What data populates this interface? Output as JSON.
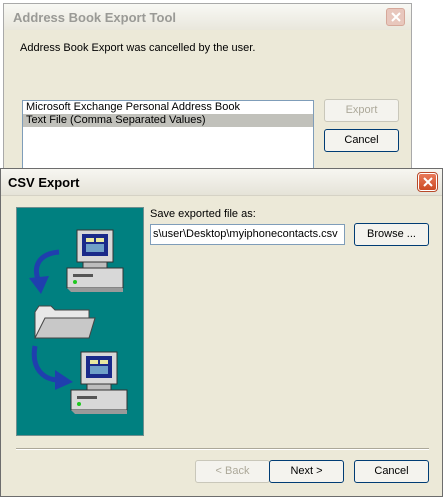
{
  "back_dialog": {
    "title": "Address Book Export Tool",
    "message": "Address Book Export was cancelled by the user.",
    "list_items": [
      {
        "label": "Microsoft Exchange Personal Address Book",
        "selected": false
      },
      {
        "label": "Text File (Comma Separated Values)",
        "selected": true
      }
    ],
    "export_label": "Export",
    "cancel_label": "Cancel"
  },
  "front_dialog": {
    "title": "CSV Export",
    "save_label": "Save exported file as:",
    "file_path": "s\\user\\Desktop\\myiphonecontacts.csv",
    "browse_label": "Browse ...",
    "back_label": "< Back",
    "next_label": "Next >",
    "cancel_label": "Cancel"
  },
  "colors": {
    "illustration_bg": "#008080",
    "arrow": "#1f3fae",
    "close_button": "#d9512c"
  }
}
